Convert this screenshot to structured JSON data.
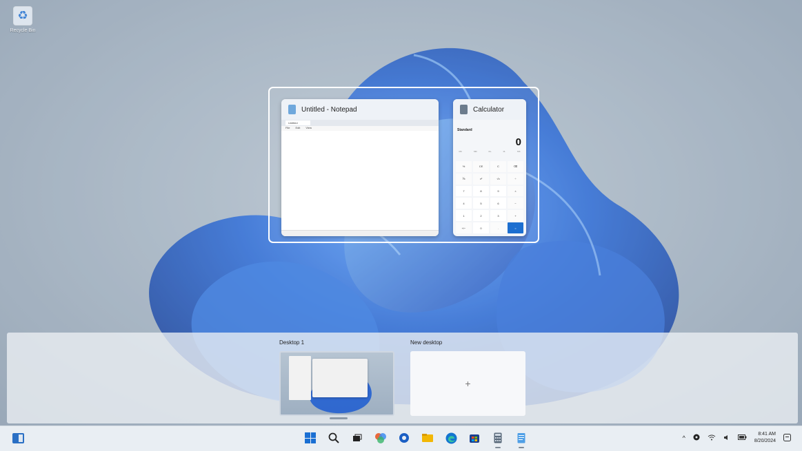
{
  "desktop": {
    "recycle_bin_label": "Recycle Bin"
  },
  "task_view": {
    "windows": [
      {
        "title": "Untitled - Notepad",
        "app": "notepad"
      },
      {
        "title": "Calculator",
        "app": "calculator"
      }
    ],
    "notepad_thumb": {
      "tab_label": "Untitled",
      "menu": [
        "File",
        "Edit",
        "View"
      ]
    },
    "calculator_thumb": {
      "mode": "Standard",
      "display": "0",
      "memory": [
        "MC",
        "MR",
        "M+",
        "M-",
        "MS"
      ],
      "keys": [
        "%",
        "CE",
        "C",
        "⌫",
        "⅟x",
        "x²",
        "√x",
        "÷",
        "7",
        "8",
        "9",
        "×",
        "4",
        "5",
        "6",
        "−",
        "1",
        "2",
        "3",
        "+",
        "+/−",
        "0",
        ".",
        "="
      ]
    },
    "desktops": [
      {
        "label": "Desktop 1"
      },
      {
        "label": "New desktop",
        "add_symbol": "+"
      }
    ]
  },
  "taskbar": {
    "icons": [
      "widgets-icon",
      "start-icon",
      "search-icon",
      "task-view-icon",
      "copilot-icon",
      "teams-icon",
      "file-explorer-icon",
      "edge-icon",
      "store-icon",
      "calculator-icon",
      "notepad-icon"
    ],
    "tray": {
      "chevron": "^",
      "time": "8:41 AM",
      "date": "8/20/2024"
    }
  },
  "colors": {
    "accent": "#1a6fd3",
    "bloom": "#1e5fd1"
  }
}
